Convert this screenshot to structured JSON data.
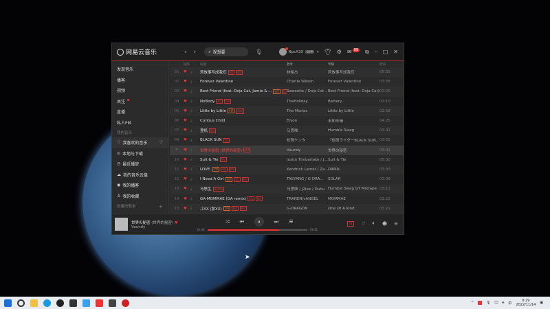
{
  "app": {
    "title": "网易云音乐",
    "search_placeholder": "视想要",
    "username": "NpcX3X",
    "vip": "SVIP",
    "mail_count": "99"
  },
  "sidebar": {
    "items": [
      "发现音乐",
      "播客",
      "视频",
      "关注",
      "直播",
      "私人FM"
    ],
    "section_my": "我的音乐",
    "my_items": [
      "我喜欢的音乐",
      "本地与下载",
      "最近播放",
      "我的音乐云盘",
      "我的播客",
      "我的收藏"
    ],
    "section_created": "创建的歌单"
  },
  "columns": {
    "ops": "操作",
    "title": "标题",
    "artist": "歌手",
    "album": "专辑",
    "duration": "时间"
  },
  "tracks": [
    {
      "n": "01",
      "t": "莉故事写成我们",
      "tags": [
        "SQ",
        "MV"
      ],
      "a": "林俊杰",
      "al": "莉故事写成我们",
      "d": "05:35"
    },
    {
      "n": "02",
      "t": "Forever Valentine",
      "tags": [],
      "a": "Charlie Wilson",
      "al": "Forever Valentine",
      "d": "03:58"
    },
    {
      "n": "03",
      "t": "Best Friend (feat. Doja Cat, Jamie & ...",
      "tags": [
        "VIP",
        "SQ"
      ],
      "a": "Saweetie / Doja Cat ...",
      "al": "Best Friend (feat. Doja Cat) [...",
      "d": "03:26"
    },
    {
      "n": "04",
      "t": "NoBody",
      "tags": [
        "SQ",
        "MV"
      ],
      "a": "TheHoliday",
      "al": "Battery",
      "d": "03:10"
    },
    {
      "n": "05",
      "t": "Little by Little",
      "tags": [
        "VIP",
        "试听"
      ],
      "a": "The Marias",
      "al": "Little by Little",
      "d": "02:58"
    },
    {
      "n": "06",
      "t": "Curious Child",
      "tags": [],
      "a": "Elyon",
      "al": "未知专辑",
      "d": "04:25"
    },
    {
      "n": "07",
      "t": "登机",
      "tags": [
        "SQ"
      ],
      "a": "马思唯",
      "al": "Humble Swag",
      "d": "02:41"
    },
    {
      "n": "08",
      "t": "BLACK SUN",
      "tags": [
        "SQ"
      ],
      "a": "松岡ケンタ",
      "al": "『仮面ライダーBLACK SUN...",
      "d": "03:55"
    },
    {
      "n": "09",
      "t": "世界の秘密 (世界的秘密)",
      "tags": [
        "MV"
      ],
      "a": "Vaundy",
      "al": "世界の秘密",
      "d": "03:41",
      "playing": true
    },
    {
      "n": "10",
      "t": "Suit & Tie",
      "tags": [
        "MV"
      ],
      "a": "Justin Timberlake / J...",
      "al": "Suit & Tie",
      "d": "05:30"
    },
    {
      "n": "11",
      "t": "LOVE.",
      "tags": [
        "VIP",
        "SQ",
        "MV"
      ],
      "a": "Kendrick Lamar / Za...",
      "al": "DAMN.",
      "d": "03:33"
    },
    {
      "n": "12",
      "t": "I Need A Girl",
      "tags": [
        "VIP",
        "SQ",
        "MV"
      ],
      "a": "TAEYANG / G-DRA...",
      "al": "SOLAR",
      "d": "03:39"
    },
    {
      "n": "13",
      "t": "马思生",
      "tags": [
        "Hi-Res"
      ],
      "a": "马思唯 / J2lee / Duhu",
      "al": "Humble Swag GT Mixtape",
      "d": "03:11"
    },
    {
      "n": "14",
      "t": "GA-MOMMAE (GA remix)",
      "tags": [
        "SQ",
        "MV"
      ],
      "a": "TRANEN/vANGEL",
      "al": "MOMMAE",
      "d": "02:22"
    },
    {
      "n": "15",
      "t": "그XX (那XX)",
      "tags": [
        "VIP",
        "SQ",
        "MV"
      ],
      "a": "G-DRAGON",
      "al": "One Of A Kind",
      "d": "03:21"
    }
  ],
  "player": {
    "title": "世界の秘密",
    "subtitle": "(世界的秘密)",
    "artist": "Vaundy",
    "elapsed": "02:40",
    "total": "03:41",
    "progress": 0.72,
    "lyrics": "词"
  },
  "taskbar": {
    "time": "0:29",
    "date": "2022/11/14"
  },
  "colors": {
    "accent": "#e33333"
  }
}
